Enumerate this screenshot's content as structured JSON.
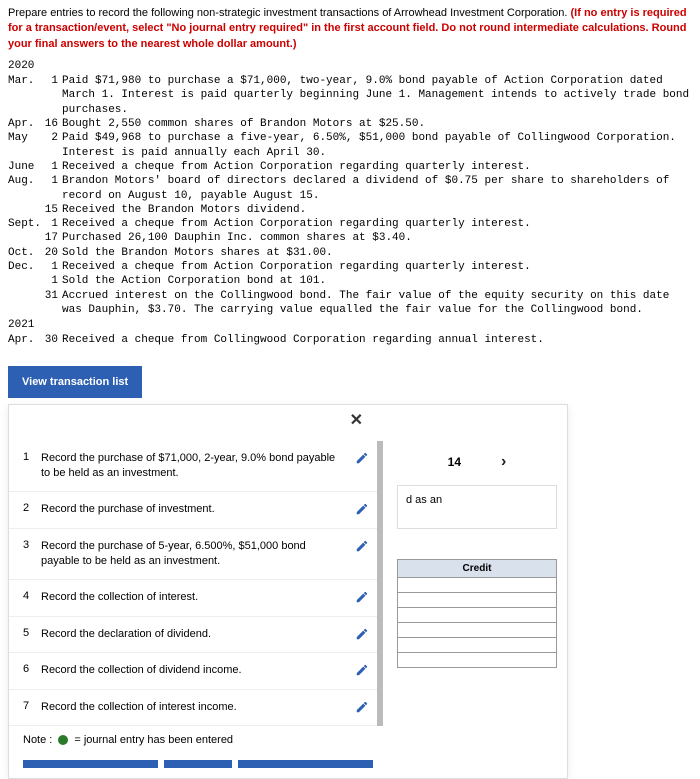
{
  "header": {
    "intro": "Prepare entries to record the following non-strategic investment transactions of Arrowhead Investment Corporation. ",
    "warn": "(If no entry is required for a transaction/event, select \"No journal entry required\" in the first account field. Do not round intermediate calculations. Round your final answers to the nearest whole dollar amount.)"
  },
  "years": {
    "y1": "2020",
    "y2": "2021"
  },
  "trans": [
    {
      "m": "Mar.",
      "d": "1",
      "t": "Paid $71,980 to purchase a $71,000, two-year, 9.0% bond payable of Action Corporation dated March 1. Interest is paid quarterly beginning June 1. Management intends to actively trade bond purchases."
    },
    {
      "m": "Apr.",
      "d": "16",
      "t": "Bought 2,550 common shares of Brandon Motors at $25.50."
    },
    {
      "m": "May",
      "d": "2",
      "t": "Paid $49,968 to purchase a five-year, 6.50%, $51,000 bond payable of Collingwood Corporation. Interest is paid annually each April 30."
    },
    {
      "m": "June",
      "d": "1",
      "t": "Received a cheque from Action Corporation regarding quarterly interest."
    },
    {
      "m": "Aug.",
      "d": "1",
      "t": "Brandon Motors' board of directors declared a dividend of $0.75 per share to shareholders of record on August 10, payable August 15."
    },
    {
      "m": "",
      "d": "15",
      "t": "Received the Brandon Motors dividend."
    },
    {
      "m": "Sept.",
      "d": "1",
      "t": "Received a cheque from Action Corporation regarding quarterly interest."
    },
    {
      "m": "",
      "d": "17",
      "t": "Purchased 26,100 Dauphin Inc. common shares at $3.40."
    },
    {
      "m": "Oct.",
      "d": "20",
      "t": "Sold the Brandon Motors shares at $31.00."
    },
    {
      "m": "Dec.",
      "d": "1",
      "t": "Received a cheque from Action Corporation regarding quarterly interest."
    },
    {
      "m": "",
      "d": "1",
      "t": "Sold the Action Corporation bond at 101."
    },
    {
      "m": "",
      "d": "31",
      "t": "Accrued interest on the Collingwood bond. The fair value of the equity security on this date was Dauphin, $3.70. The carrying value equalled the fair value for the Collingwood bond."
    }
  ],
  "trans2021": [
    {
      "m": "Apr.",
      "d": "30",
      "t": "Received a cheque from Collingwood Corporation regarding annual interest."
    }
  ],
  "viewBtn": "View transaction list",
  "list": [
    {
      "n": "1",
      "t": "Record the purchase of $71,000, 2-year, 9.0% bond payable to be held as an investment."
    },
    {
      "n": "2",
      "t": "Record the purchase of investment."
    },
    {
      "n": "3",
      "t": "Record the purchase of 5-year, 6.500%, $51,000 bond payable to be held as an investment."
    },
    {
      "n": "4",
      "t": "Record the collection of interest."
    },
    {
      "n": "5",
      "t": "Record the declaration of dividend."
    },
    {
      "n": "6",
      "t": "Record the collection of dividend income."
    },
    {
      "n": "7",
      "t": "Record the collection of interest income."
    }
  ],
  "nav": {
    "num": "14"
  },
  "snippet": "d as an",
  "credit": "Credit",
  "note": {
    "label": "Note :",
    "text": "= journal entry has been entered"
  }
}
